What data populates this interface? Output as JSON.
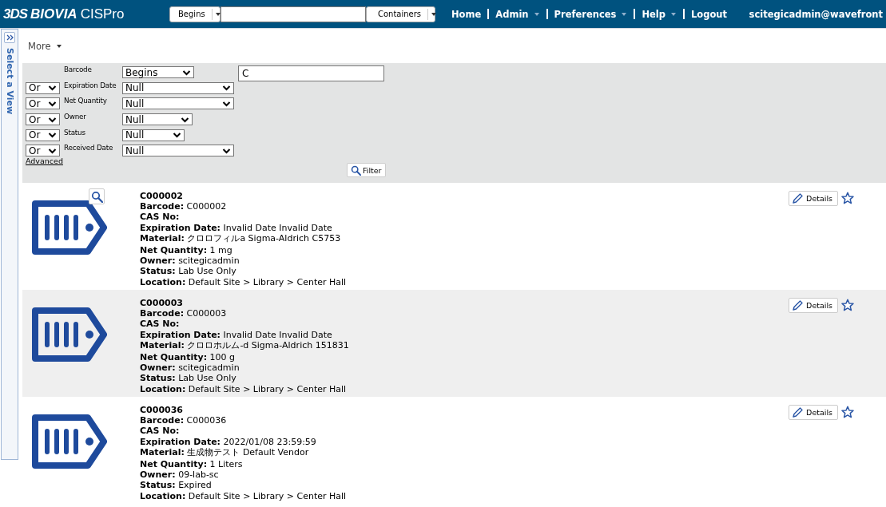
{
  "header": {
    "brand_mark": "3DS",
    "brand": "BIOVIA",
    "product": "CISPro",
    "search": {
      "mode": "Begins",
      "scope": "Containers"
    },
    "nav": [
      {
        "label": "Home",
        "dropdown": false
      },
      {
        "label": "Admin",
        "dropdown": true
      },
      {
        "label": "Preferences",
        "dropdown": true
      },
      {
        "label": "Help",
        "dropdown": true
      },
      {
        "label": "Logout",
        "dropdown": false
      }
    ],
    "user": "scitegicadmin@wavefront"
  },
  "sidebar": {
    "label": "Select a View",
    "collapsed": true
  },
  "toolbar": {
    "more": "More"
  },
  "filter": {
    "rows": [
      {
        "conjunction": "",
        "field": "Barcode",
        "operator": "Begins",
        "value": "C"
      },
      {
        "conjunction": "Or",
        "field": "Expiration Date",
        "operator": "Null"
      },
      {
        "conjunction": "Or",
        "field": "Net Quantity",
        "operator": "Null"
      },
      {
        "conjunction": "Or",
        "field": "Owner",
        "operator": "Null"
      },
      {
        "conjunction": "Or",
        "field": "Status",
        "operator": "Null"
      },
      {
        "conjunction": "Or",
        "field": "Received Date",
        "operator": "Null"
      }
    ],
    "advanced": "Advanced",
    "button": "Filter"
  },
  "results": [
    {
      "title": "C000002",
      "preview": true,
      "favorite": false,
      "details": "Details",
      "groups": [
        [
          {
            "label": "Barcode:",
            "value": "C000002"
          },
          {
            "label": "CAS No:"
          },
          {
            "label": "Expiration Date:",
            "value": "Invalid Date Invalid Date"
          },
          {
            "label": "Material:",
            "value": "クロロフィルa Sigma-Aldrich C5753"
          }
        ],
        [
          {
            "label": "Net Quantity:",
            "value": "1 mg"
          },
          {
            "label": "Owner:",
            "value": "scitegicadmin"
          },
          {
            "label": "Status:",
            "value": "Lab Use Only"
          },
          {
            "label": "Location:",
            "value": "Default Site > Library > Center Hall"
          }
        ]
      ]
    },
    {
      "title": "C000003",
      "preview": false,
      "favorite": false,
      "details": "Details",
      "groups": [
        [
          {
            "label": "Barcode:",
            "value": "C000003"
          },
          {
            "label": "CAS No:"
          },
          {
            "label": "Expiration Date:",
            "value": "Invalid Date Invalid Date"
          },
          {
            "label": "Material:",
            "value": "クロロホルム-d Sigma-Aldrich 151831"
          }
        ],
        [
          {
            "label": "Net Quantity:",
            "value": "100 g"
          },
          {
            "label": "Owner:",
            "value": "scitegicadmin"
          },
          {
            "label": "Status:",
            "value": "Lab Use Only"
          },
          {
            "label": "Location:",
            "value": "Default Site > Library > Center Hall"
          }
        ]
      ]
    },
    {
      "title": "C000036",
      "preview": false,
      "favorite": false,
      "details": "Details",
      "groups": [
        [
          {
            "label": "Barcode:",
            "value": "C000036"
          },
          {
            "label": "CAS No:"
          },
          {
            "label": "Expiration Date:",
            "value": "2022/01/08 23:59:59"
          },
          {
            "label": "Material:",
            "value": "生成物テスト Default Vendor"
          }
        ],
        [
          {
            "label": "Net Quantity:",
            "value": "1 Liters"
          },
          {
            "label": "Owner:",
            "value": "09-lab-sc"
          },
          {
            "label": "Status:",
            "value": "Expired"
          },
          {
            "label": "Location:",
            "value": "Default Site > Library > Center Hall"
          }
        ]
      ]
    }
  ]
}
